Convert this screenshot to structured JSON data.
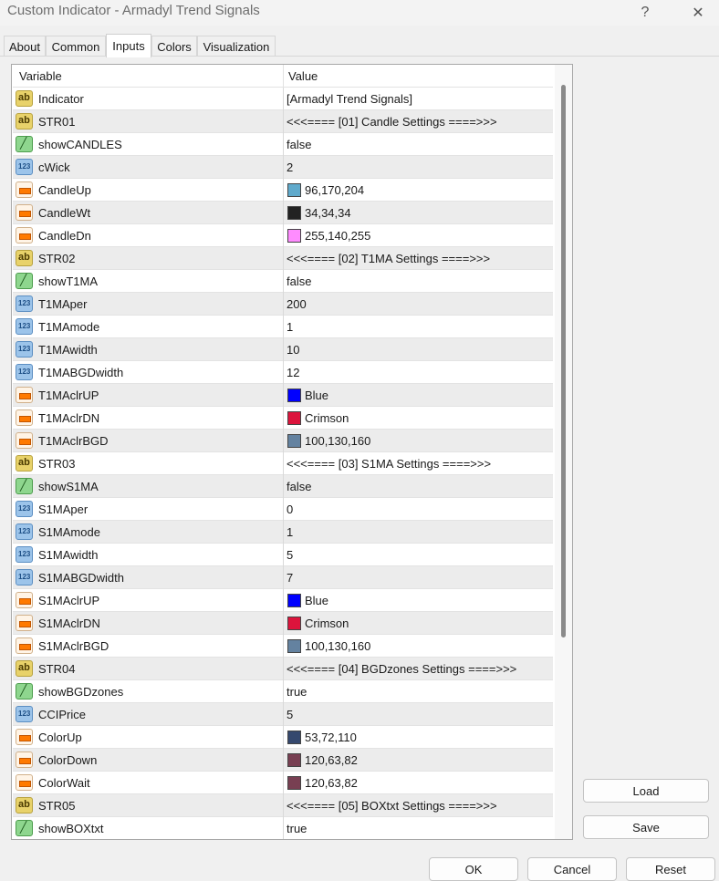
{
  "window": {
    "title": "Custom Indicator - Armadyl Trend Signals",
    "help_glyph": "?",
    "close_glyph": "✕"
  },
  "tabs": [
    {
      "label": "About",
      "active": false
    },
    {
      "label": "Common",
      "active": false
    },
    {
      "label": "Inputs",
      "active": true
    },
    {
      "label": "Colors",
      "active": false
    },
    {
      "label": "Visualization",
      "active": false
    }
  ],
  "grid": {
    "headers": {
      "variable": "Variable",
      "value": "Value"
    },
    "rows": [
      {
        "type": "string",
        "icon": "string-type-icon",
        "name": "Indicator",
        "value": "[Armadyl Trend Signals]"
      },
      {
        "type": "string",
        "icon": "string-type-icon",
        "name": "STR01",
        "value": "<<<==== [01] Candle Settings ====>>>"
      },
      {
        "type": "bool",
        "icon": "bool-type-icon",
        "name": "showCANDLES",
        "value": "false"
      },
      {
        "type": "int",
        "icon": "number-type-icon",
        "name": "cWick",
        "value": "2"
      },
      {
        "type": "color",
        "icon": "color-type-icon",
        "name": "CandleUp",
        "value": "96,170,204",
        "swatch": "#60aacc"
      },
      {
        "type": "color",
        "icon": "color-type-icon",
        "name": "CandleWt",
        "value": "34,34,34",
        "swatch": "#222222"
      },
      {
        "type": "color",
        "icon": "color-type-icon",
        "name": "CandleDn",
        "value": "255,140,255",
        "swatch": "#ff8cff"
      },
      {
        "type": "string",
        "icon": "string-type-icon",
        "name": "STR02",
        "value": "<<<==== [02] T1MA Settings ====>>>"
      },
      {
        "type": "bool",
        "icon": "bool-type-icon",
        "name": "showT1MA",
        "value": "false"
      },
      {
        "type": "int",
        "icon": "number-type-icon",
        "name": "T1MAper",
        "value": "200"
      },
      {
        "type": "int",
        "icon": "number-type-icon",
        "name": "T1MAmode",
        "value": "1"
      },
      {
        "type": "int",
        "icon": "number-type-icon",
        "name": "T1MAwidth",
        "value": "10"
      },
      {
        "type": "int",
        "icon": "number-type-icon",
        "name": "T1MABGDwidth",
        "value": "12"
      },
      {
        "type": "color",
        "icon": "color-type-icon",
        "name": "T1MAclrUP",
        "value": "Blue",
        "swatch": "#0000ff"
      },
      {
        "type": "color",
        "icon": "color-type-icon",
        "name": "T1MAclrDN",
        "value": "Crimson",
        "swatch": "#dc143c"
      },
      {
        "type": "color",
        "icon": "color-type-icon",
        "name": "T1MAclrBGD",
        "value": "100,130,160",
        "swatch": "#6482a0"
      },
      {
        "type": "string",
        "icon": "string-type-icon",
        "name": "STR03",
        "value": "<<<==== [03] S1MA Settings ====>>>"
      },
      {
        "type": "bool",
        "icon": "bool-type-icon",
        "name": "showS1MA",
        "value": "false"
      },
      {
        "type": "int",
        "icon": "number-type-icon",
        "name": "S1MAper",
        "value": "0"
      },
      {
        "type": "int",
        "icon": "number-type-icon",
        "name": "S1MAmode",
        "value": "1"
      },
      {
        "type": "int",
        "icon": "number-type-icon",
        "name": "S1MAwidth",
        "value": "5"
      },
      {
        "type": "int",
        "icon": "number-type-icon",
        "name": "S1MABGDwidth",
        "value": "7"
      },
      {
        "type": "color",
        "icon": "color-type-icon",
        "name": "S1MAclrUP",
        "value": "Blue",
        "swatch": "#0000ff"
      },
      {
        "type": "color",
        "icon": "color-type-icon",
        "name": "S1MAclrDN",
        "value": "Crimson",
        "swatch": "#dc143c"
      },
      {
        "type": "color",
        "icon": "color-type-icon",
        "name": "S1MAclrBGD",
        "value": "100,130,160",
        "swatch": "#6482a0"
      },
      {
        "type": "string",
        "icon": "string-type-icon",
        "name": "STR04",
        "value": "<<<==== [04] BGDzones Settings ====>>>"
      },
      {
        "type": "bool",
        "icon": "bool-type-icon",
        "name": "showBGDzones",
        "value": "true"
      },
      {
        "type": "int",
        "icon": "number-type-icon",
        "name": "CCIPrice",
        "value": "5"
      },
      {
        "type": "color",
        "icon": "color-type-icon",
        "name": "ColorUp",
        "value": "53,72,110",
        "swatch": "#35486e"
      },
      {
        "type": "color",
        "icon": "color-type-icon",
        "name": "ColorDown",
        "value": "120,63,82",
        "swatch": "#783f52"
      },
      {
        "type": "color",
        "icon": "color-type-icon",
        "name": "ColorWait",
        "value": "120,63,82",
        "swatch": "#783f52"
      },
      {
        "type": "string",
        "icon": "string-type-icon",
        "name": "STR05",
        "value": "<<<==== [05] BOXtxt Settings ====>>>"
      },
      {
        "type": "bool",
        "icon": "bool-type-icon",
        "name": "showBOXtxt",
        "value": "true"
      }
    ]
  },
  "side_buttons": {
    "load": "Load",
    "save": "Save"
  },
  "footer_buttons": {
    "ok": "OK",
    "cancel": "Cancel",
    "reset": "Reset"
  }
}
